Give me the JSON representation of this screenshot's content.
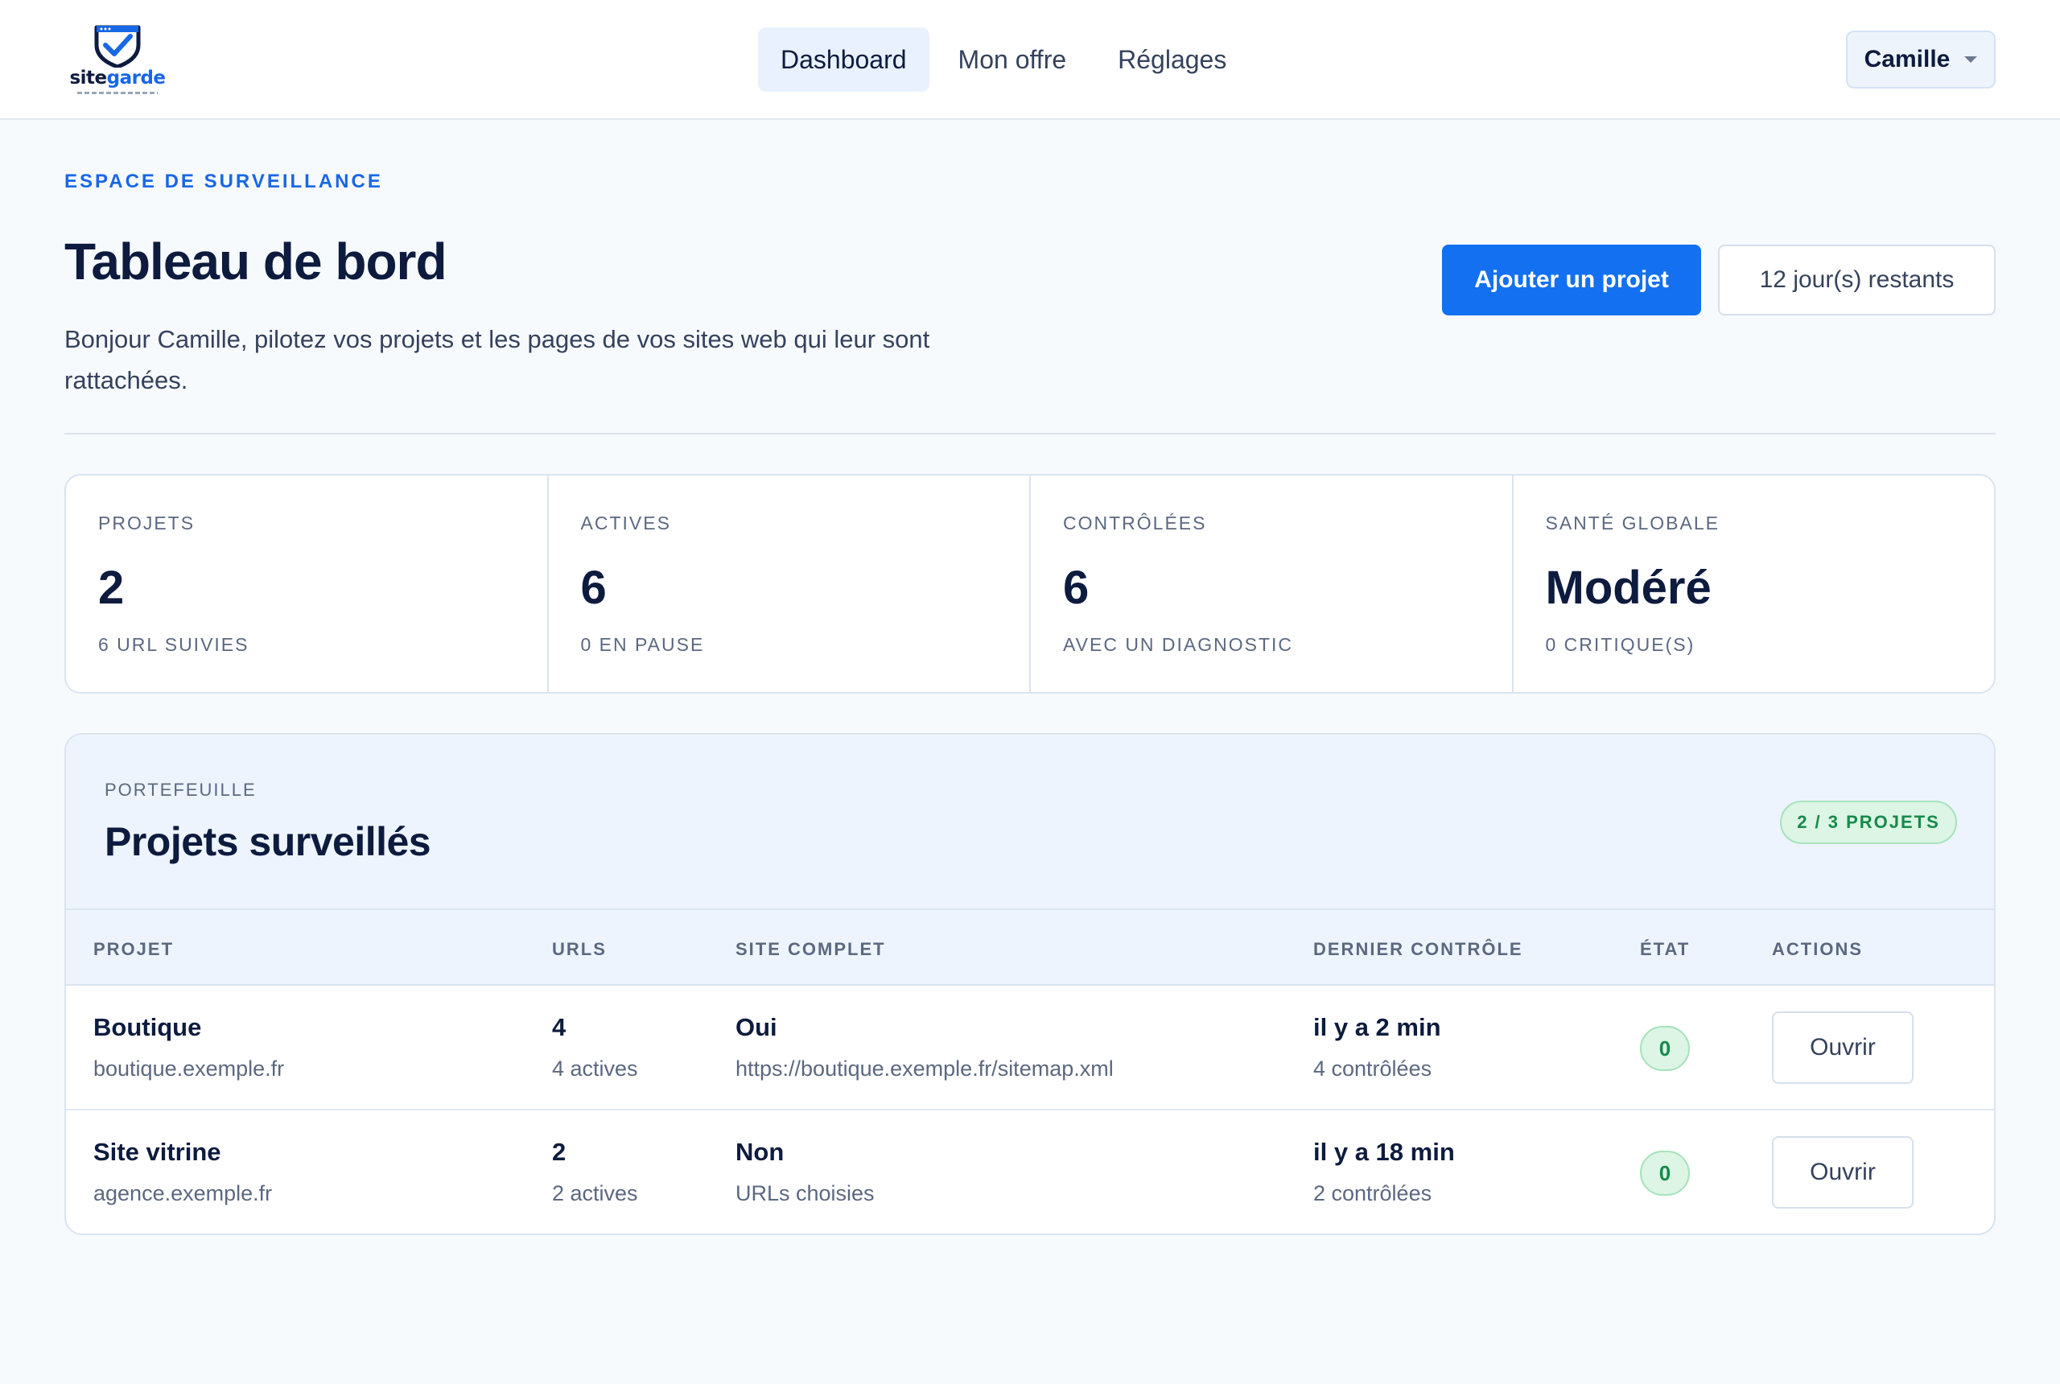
{
  "brand": {
    "name_part1": "site",
    "name_part2": "garde"
  },
  "nav": {
    "items": [
      {
        "label": "Dashboard",
        "active": true
      },
      {
        "label": "Mon offre",
        "active": false
      },
      {
        "label": "Réglages",
        "active": false
      }
    ]
  },
  "user": {
    "name": "Camille"
  },
  "header": {
    "eyebrow": "ESPACE DE SURVEILLANCE",
    "title": "Tableau de bord",
    "subtitle": "Bonjour Camille, pilotez vos projets et les pages de vos sites web qui leur sont rattachées.",
    "add_project_label": "Ajouter un projet",
    "trial_label": "12 jour(s) restants"
  },
  "stats": [
    {
      "label": "PROJETS",
      "value": "2",
      "note": "6 URL SUIVIES"
    },
    {
      "label": "ACTIVES",
      "value": "6",
      "note": "0 EN PAUSE"
    },
    {
      "label": "CONTRÔLÉES",
      "value": "6",
      "note": "AVEC UN DIAGNOSTIC"
    },
    {
      "label": "SANTÉ GLOBALE",
      "value": "Modéré",
      "note": "0 CRITIQUE(S)"
    }
  ],
  "projects_panel": {
    "eyebrow": "PORTEFEUILLE",
    "title": "Projets surveillés",
    "quota": "2 / 3 PROJETS",
    "columns": [
      "PROJET",
      "URLS",
      "SITE COMPLET",
      "DERNIER CONTRÔLE",
      "ÉTAT",
      "ACTIONS"
    ],
    "rows": [
      {
        "name": "Boutique",
        "domain": "boutique.exemple.fr",
        "urls": "4",
        "urls_note": "4 actives",
        "full_site": "Oui",
        "full_site_note": "https://boutique.exemple.fr/sitemap.xml",
        "last_check": "il y a 2 min",
        "last_check_note": "4 contrôlées",
        "state": "0",
        "action": "Ouvrir"
      },
      {
        "name": "Site vitrine",
        "domain": "agence.exemple.fr",
        "urls": "2",
        "urls_note": "2 actives",
        "full_site": "Non",
        "full_site_note": "URLs choisies",
        "last_check": "il y a 18 min",
        "last_check_note": "2 contrôlées",
        "state": "0",
        "action": "Ouvrir"
      }
    ]
  },
  "icons": {
    "logo": "shield-check-icon",
    "user_menu": "chevron-down-icon"
  },
  "colors": {
    "accent": "#1370f0",
    "brand_dark": "#0d1b3e",
    "success": "#168a4a"
  }
}
